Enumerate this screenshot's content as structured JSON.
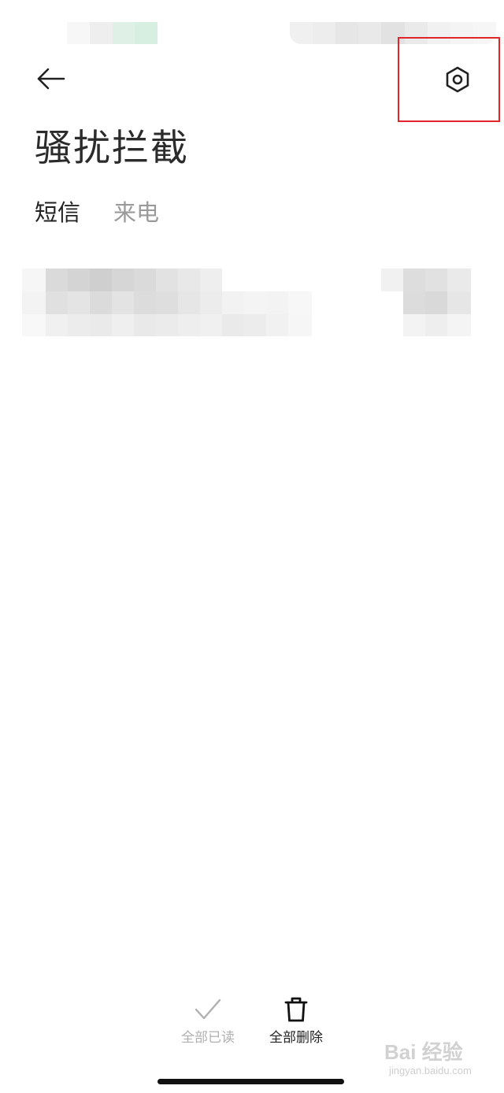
{
  "header": {
    "title": "骚扰拦截"
  },
  "tabs": [
    {
      "label": "短信",
      "active": true
    },
    {
      "label": "来电",
      "active": false
    }
  ],
  "bottom_actions": {
    "mark_all_read": "全部已读",
    "delete_all": "全部删除"
  },
  "watermark": {
    "brand": "Bai 经验",
    "url": "jingyan.baidu.com"
  },
  "colors": {
    "highlight_box": "#e0262b",
    "text_primary": "#222222",
    "text_secondary": "#9a9a9a",
    "background": "#ffffff"
  },
  "icons": {
    "back": "arrow-left-icon",
    "settings": "hex-gear-icon",
    "mark_read": "checkmark-icon",
    "delete": "trash-icon"
  }
}
